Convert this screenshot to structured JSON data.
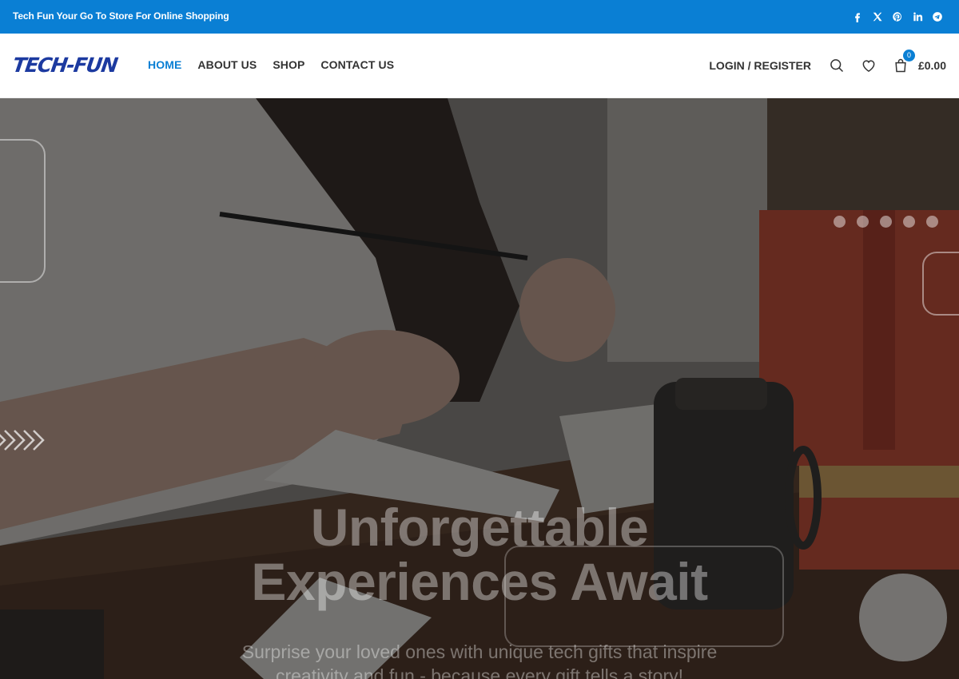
{
  "topbar": {
    "tagline": "Tech Fun Your Go To Store For Online Shopping",
    "socials": [
      "facebook-icon",
      "x-icon",
      "pinterest-icon",
      "linkedin-icon",
      "telegram-icon"
    ],
    "color": "#0a7fd4"
  },
  "header": {
    "logo_text": "TECH-FUN",
    "nav": [
      "HOME",
      "ABOUT US",
      "SHOP",
      "CONTACT US"
    ],
    "active_nav": "HOME",
    "login_label": "LOGIN / REGISTER",
    "cart_count": "0",
    "cart_total": "£0.00"
  },
  "hero": {
    "title_line1": "Unforgettable",
    "title_line2": "Experiences Await",
    "subtitle_line1": "Surprise your loved ones with unique tech gifts that inspire",
    "subtitle_line2": "creativity and fun - because every gift tells a story!",
    "slide_count": 5
  }
}
